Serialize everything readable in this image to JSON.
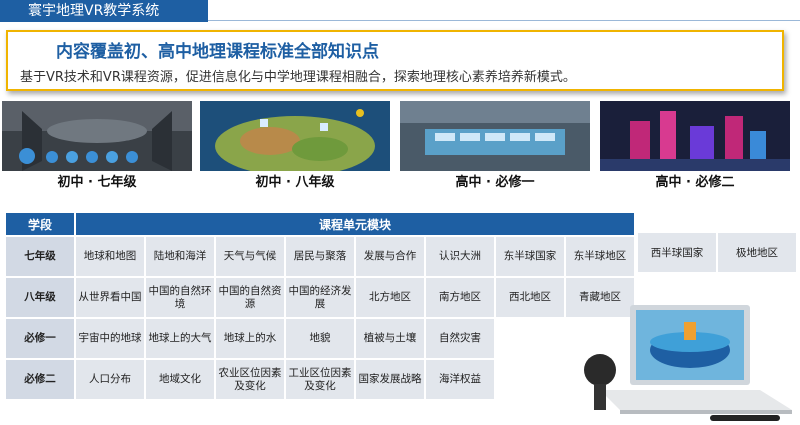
{
  "header": {
    "title": "寰宇地理VR教学系统"
  },
  "banner": {
    "heading": "内容覆盖初、高中地理课程标准全部知识点",
    "subtitle": "基于VR技术和VR课程资源，促进信息化与中学地理课程相融合，探索地理核心素养培养新模式。"
  },
  "panels": [
    {
      "caption": "初中 · 七年级"
    },
    {
      "caption": "初中 · 八年级"
    },
    {
      "caption": "高中 · 必修一"
    },
    {
      "caption": "高中 · 必修二"
    }
  ],
  "table": {
    "header_stage": "学段",
    "header_modules": "课程单元模块",
    "rows": [
      {
        "stage": "七年级",
        "cells": [
          "地球和地图",
          "陆地和海洋",
          "天气与气候",
          "居民与聚落",
          "发展与合作",
          "认识大洲",
          "东半球国家",
          "东半球地区",
          "西半球国家",
          "极地地区"
        ]
      },
      {
        "stage": "八年级",
        "cells": [
          "从世界看中国",
          "中国的自然环境",
          "中国的自然资源",
          "中国的经济发展",
          "北方地区",
          "南方地区",
          "西北地区",
          "青藏地区"
        ]
      },
      {
        "stage": "必修一",
        "cells": [
          "宇宙中的地球",
          "地球上的大气",
          "地球上的水",
          "地貌",
          "植被与土壤",
          "自然灾害"
        ]
      },
      {
        "stage": "必修二",
        "cells": [
          "人口分布",
          "地域文化",
          "农业区位因素及变化",
          "工业区位因素及变化",
          "国家发展战略",
          "海洋权益"
        ]
      }
    ]
  },
  "colors": {
    "accent": "#1e5fa3",
    "border": "#f0b400"
  }
}
